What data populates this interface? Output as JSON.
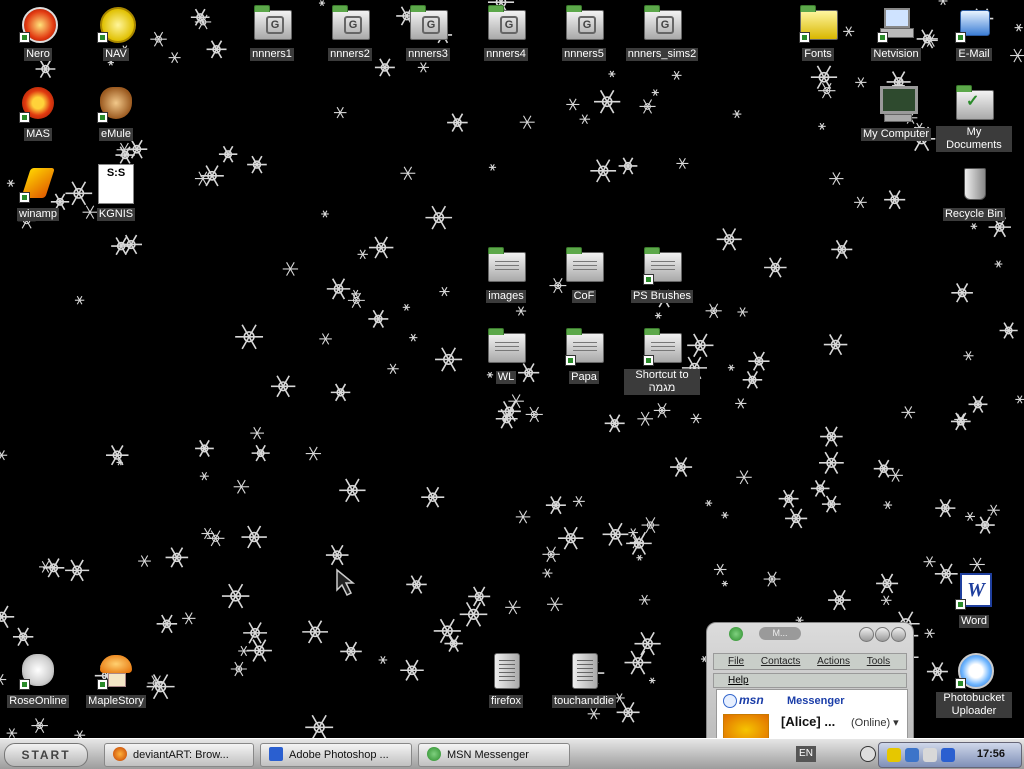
{
  "desktop": {
    "icons": {
      "nero": "Nero",
      "nav": "NAV",
      "nnners1": "nnners1",
      "nnners2": "nnners2",
      "nnners3": "nnners3",
      "nnners4": "nnners4",
      "nnners5": "nnners5",
      "nnners_sims2": "nnners_sims2",
      "fonts": "Fonts",
      "netvision": "Netvision",
      "email": "E-Mail",
      "mas": "MAS",
      "emule": "eMule",
      "my_computer": "My Computer",
      "my_documents": "My Documents",
      "winamp": "winamp",
      "kgnis": "KGNIS",
      "recycle_bin": "Recycle Bin",
      "images": "images",
      "cof": "CoF",
      "ps_brushes": "PS Brushes",
      "wl": "WL",
      "papa": "Papa",
      "shortcut": "Shortcut to מגמה",
      "word": "Word",
      "roseonline": "RoseOnline",
      "maplestory": "MapleStory",
      "firefox": "firefox",
      "touchanddie": "touchanddie",
      "photobucket": "Photobucket Uploader"
    }
  },
  "msn": {
    "title_pill": "M...",
    "menu": [
      "File",
      "Contacts",
      "Actions",
      "Tools"
    ],
    "help": "Help",
    "brand": "msn",
    "brand_suffix": "Messenger",
    "user_name": "[Alice] ...",
    "user_status": "(Online) ▾"
  },
  "taskbar": {
    "start_label": "START",
    "tasks": [
      "deviantART: Brow...",
      "Adobe Photoshop ...",
      "MSN Messenger"
    ],
    "language": "EN",
    "clock": "17:56"
  },
  "colors": {
    "desktop_bg": "#000000",
    "label_bg": "#3b3b3b",
    "tray_bg": "#9aa6c8"
  }
}
